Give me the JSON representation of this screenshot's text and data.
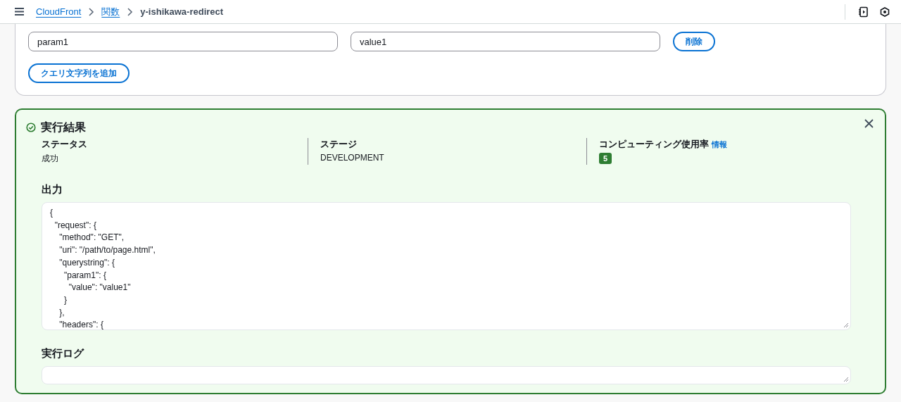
{
  "breadcrumbs": [
    {
      "label": "CloudFront",
      "kind": "link"
    },
    {
      "label": "関数",
      "kind": "link"
    },
    {
      "label": "y-ishikawa-redirect",
      "kind": "current"
    }
  ],
  "query_strings": {
    "rows": [
      {
        "key": "param1",
        "value": "value1",
        "remove_button": "削除"
      }
    ],
    "add_button": "クエリ文字列を追加"
  },
  "result": {
    "title": "実行結果",
    "succeeded": true,
    "columns": [
      {
        "label": "ステータス",
        "value": "成功",
        "kind": "text"
      },
      {
        "label": "ステージ",
        "value": "DEVELOPMENT",
        "kind": "text"
      },
      {
        "label": "コンピューティング使用率",
        "info_link": "情報",
        "value": "5",
        "kind": "badge"
      }
    ],
    "output": {
      "heading": "出力",
      "lines": [
        "{",
        "  \"request\": {",
        "    \"method\": \"GET\",",
        "    \"uri\": \"/path/to/page.html\",",
        "    \"querystring\": {",
        "      \"param1\": {",
        "        \"value\": \"value1\"",
        "      }",
        "    },",
        "    \"headers\": {"
      ]
    },
    "log": {
      "heading": "実行ログ"
    }
  }
}
